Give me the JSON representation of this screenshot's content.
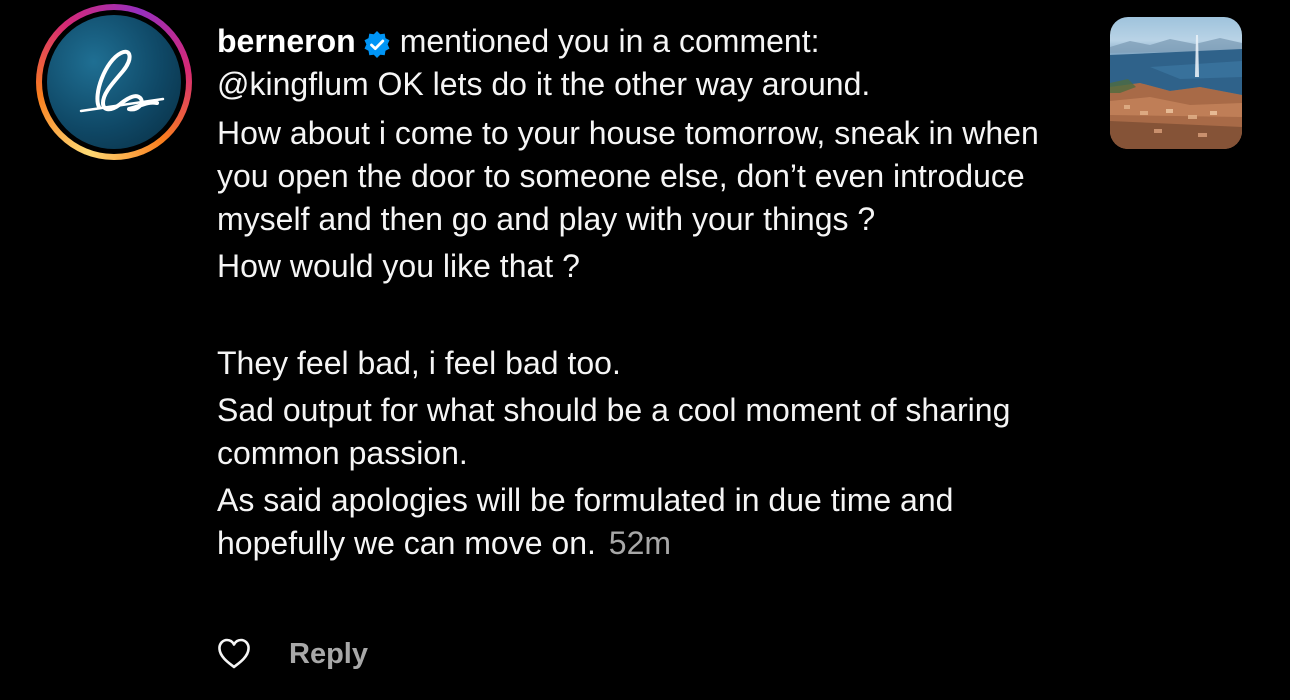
{
  "notification": {
    "username": "berneron",
    "verified": true,
    "action": "mentioned you in a comment:",
    "comment_lines": [
      "@kingflum OK lets do it the other way around.",
      "How about i come to your house tomorrow, sneak in when you open the door to someone else, don’t even introduce myself and then go and play with your things ?",
      "How would you like that ?",
      "They feel bad, i feel bad too.",
      "Sad output for what should be a cool moment of sharing common passion.",
      "As said apologies will be formulated in due time and hopefully we can move on."
    ],
    "timestamp": "52m",
    "reply_label": "Reply",
    "avatar_icon": "cursive-b-logo",
    "thumbnail_icon": "lake-city-photo"
  },
  "colors": {
    "background": "#000000",
    "text": "#f5f5f5",
    "muted": "#a8a8a8",
    "verified_badge": "#0095f6"
  }
}
